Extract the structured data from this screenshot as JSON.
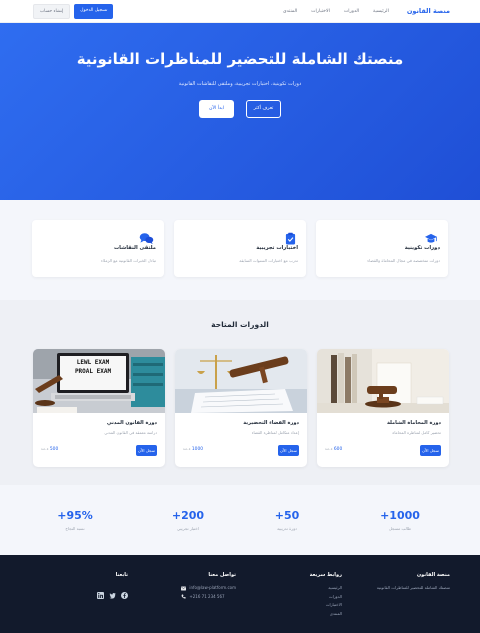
{
  "nav": {
    "brand": "منصة القانون",
    "links": [
      "الرئيسية",
      "الدورات",
      "الاختبارات",
      "المنتدى"
    ],
    "login": "تسجيل الدخول",
    "register": "إنشاء حساب"
  },
  "hero": {
    "title": "منصتك الشاملة للتحضير للمناظرات القانونية",
    "subtitle": "دورات تكوينية، اختبارات تجريبية، وملتقى للنقاشات القانونية",
    "cta_primary": "ابدأ الآن",
    "cta_secondary": "تعرف أكثر"
  },
  "features": [
    {
      "icon": "graduation-cap-icon",
      "title": "دورات تكوينية",
      "desc": "دورات متخصصة في مجال المحاماة والقضاء"
    },
    {
      "icon": "clipboard-check-icon",
      "title": "اختبارات تجريبية",
      "desc": "تدرب مع اختبارات السنوات السابقة"
    },
    {
      "icon": "comments-icon",
      "title": "ملتقى النقاشات",
      "desc": "تبادل الخبرات القانونية مع الزملاء"
    }
  ],
  "courses": {
    "title": "الدورات المتاحة",
    "items": [
      {
        "title": "دورة المحاماة الشاملة",
        "desc": "تحضير كامل لمناظرة المحاماة",
        "price": "600",
        "currency": "د.ت",
        "button": "سجل الآن",
        "image": "gavel-books-icon"
      },
      {
        "title": "دورة القضاء التحضيرية",
        "desc": "إعداد متكامل لمناظرة القضاء",
        "price": "1000",
        "currency": "د.ت",
        "button": "سجل الآن",
        "image": "scales-justice-icon"
      },
      {
        "title": "دورة القانون المدني",
        "desc": "دراسة معمقة في القانون المدني",
        "price": "500",
        "currency": "د.ت",
        "button": "سجل الآن",
        "image": "laptop-exam-icon",
        "image_text": [
          "LEWL EXAM",
          "PROAL EXAM"
        ]
      }
    ]
  },
  "stats": [
    {
      "num": "1000+",
      "label": "طالب مسجل"
    },
    {
      "num": "50+",
      "label": "دورة تدريبية"
    },
    {
      "num": "200+",
      "label": "اختبار تجريبي"
    },
    {
      "num": "95%+",
      "label": "نسبة النجاح"
    }
  ],
  "footer": {
    "about_title": "منصة القانون",
    "about_text": "منصتك الشاملة للتحضير للمناظرات القانونية",
    "links_title": "روابط سريعة",
    "links": [
      "الرئيسية",
      "الدورات",
      "الاختبارات",
      "المنتدى"
    ],
    "contact_title": "تواصل معنا",
    "email": "info@law-platform.com",
    "phone": "+216 71 234 567",
    "follow_title": "تابعنا"
  },
  "colors": {
    "primary": "#2563eb",
    "footer": "#121a2c"
  }
}
